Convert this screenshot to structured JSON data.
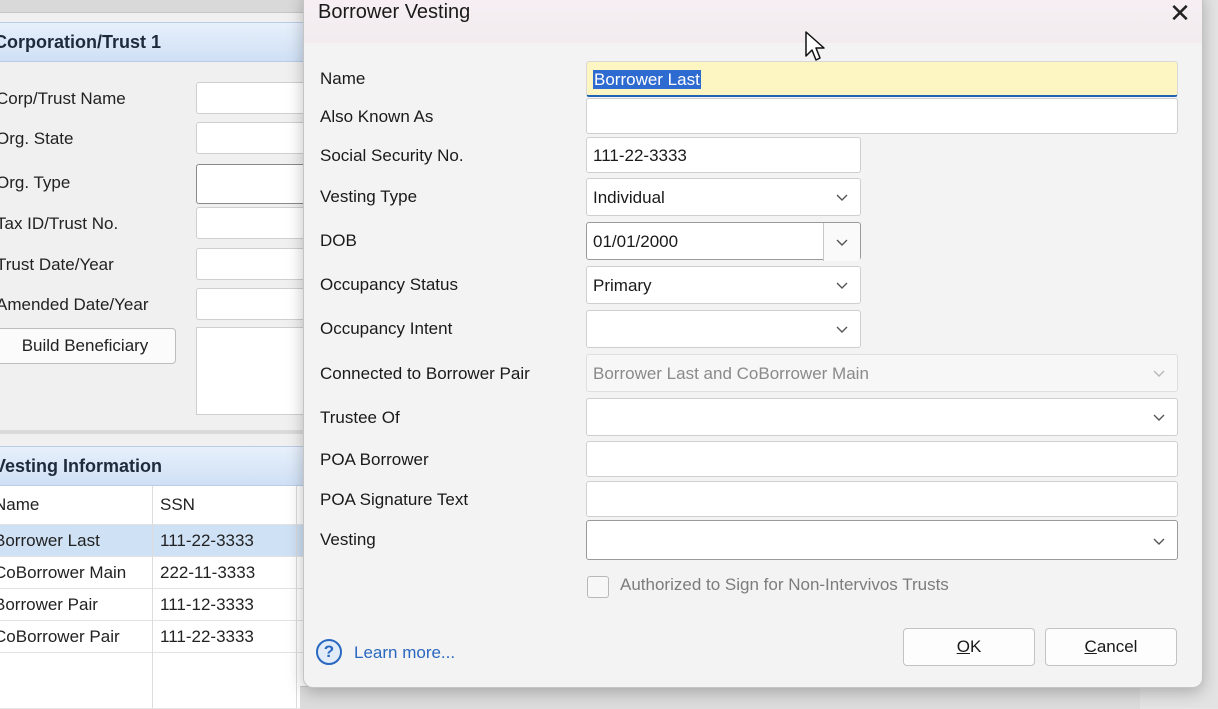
{
  "background_window": {
    "corp_section": {
      "title": "Corporation/Trust 1",
      "labels": [
        "Corp/Trust Name",
        "Org. State",
        "Org. Type",
        "Tax ID/Trust No.",
        "Trust Date/Year",
        "Amended Date/Year"
      ],
      "build_beneficiary_label": "Build Beneficiary"
    },
    "vesting_section": {
      "title": "Vesting Information",
      "columns": [
        "Name",
        "SSN"
      ],
      "rows": [
        {
          "name": "Borrower Last",
          "ssn": "111-22-3333"
        },
        {
          "name": "CoBorrower Main",
          "ssn": "222-11-3333"
        },
        {
          "name": "Borrower Pair",
          "ssn": "111-12-3333"
        },
        {
          "name": "CoBorrower Pair",
          "ssn": "111-22-3333"
        }
      ]
    }
  },
  "dialog": {
    "title": "Borrower Vesting",
    "close_glyph": "✕",
    "fields": {
      "name": {
        "label": "Name",
        "value": "Borrower Last"
      },
      "aka": {
        "label": "Also Known As",
        "value": ""
      },
      "ssn": {
        "label": "Social Security No.",
        "value": "111-22-3333"
      },
      "vesting_type": {
        "label": "Vesting Type",
        "value": "Individual"
      },
      "dob": {
        "label": "DOB",
        "value": "01/01/2000"
      },
      "occupancy_status": {
        "label": "Occupancy Status",
        "value": "Primary"
      },
      "occupancy_intent": {
        "label": "Occupancy Intent",
        "value": ""
      },
      "connected_pair": {
        "label": "Connected to Borrower Pair",
        "value": "Borrower Last and CoBorrower Main"
      },
      "trustee_of": {
        "label": "Trustee Of",
        "value": ""
      },
      "poa_borrower": {
        "label": "POA Borrower",
        "value": ""
      },
      "poa_signature": {
        "label": "POA Signature Text",
        "value": ""
      },
      "vesting": {
        "label": "Vesting",
        "value": ""
      }
    },
    "authorized_checkbox": {
      "label": "Authorized to Sign for Non-Intervivos Trusts",
      "checked": false
    },
    "help_glyph": "?",
    "learn_more": "Learn more...",
    "ok_label_accel": "O",
    "ok_label_rest": "K",
    "cancel_label_accel": "C",
    "cancel_label_rest": "ancel"
  },
  "colors": {
    "accent": "#2a68c0",
    "name_field_bg": "#fdf6c3",
    "selected_row": "#cfe1f5"
  }
}
